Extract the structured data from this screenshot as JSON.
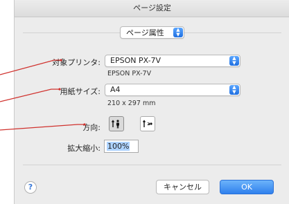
{
  "dialog": {
    "title": "ページ設定",
    "mode_popup": "ページ属性",
    "printer": {
      "label": "対象プリンタ:",
      "value": "EPSON PX-7V",
      "sub": "EPSON PX-7V"
    },
    "paper": {
      "label": "用紙サイズ:",
      "value": "A4",
      "sub": "210 x 297 mm"
    },
    "orientation": {
      "label": "方向:",
      "selected": "portrait"
    },
    "scale": {
      "label": "拡大縮小:",
      "value": "100%"
    },
    "help_label": "?",
    "cancel_label": "キャンセル",
    "ok_label": "OK"
  },
  "colors": {
    "accent": "#2f80ed",
    "callout": "#d0312d"
  }
}
